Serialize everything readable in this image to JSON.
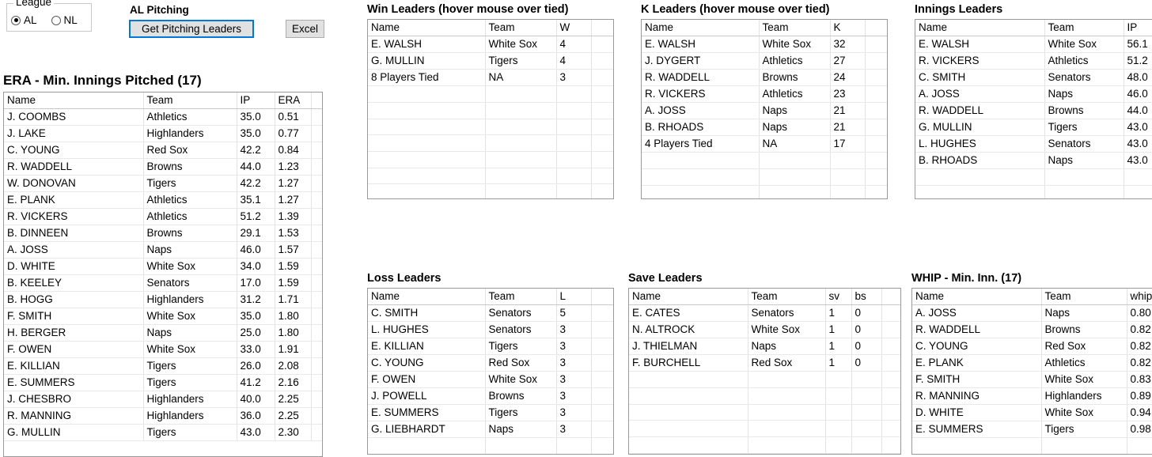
{
  "controls": {
    "league_legend": "League",
    "options": [
      {
        "label": "AL",
        "checked": true
      },
      {
        "label": "NL",
        "checked": false
      }
    ],
    "pitching_title": "AL Pitching",
    "get_leaders_label": "Get Pitching Leaders",
    "excel_label": "Excel"
  },
  "era": {
    "title": "ERA - Min. Innings Pitched (17)",
    "columns": [
      "Name",
      "Team",
      "IP",
      "ERA"
    ],
    "rows": [
      [
        "J. COOMBS",
        "Athletics",
        "35.0",
        "0.51"
      ],
      [
        "J. LAKE",
        "Highlanders",
        "35.0",
        "0.77"
      ],
      [
        "C. YOUNG",
        "Red Sox",
        "42.2",
        "0.84"
      ],
      [
        "R. WADDELL",
        "Browns",
        "44.0",
        "1.23"
      ],
      [
        "W. DONOVAN",
        "Tigers",
        "42.2",
        "1.27"
      ],
      [
        "E. PLANK",
        "Athletics",
        "35.1",
        "1.27"
      ],
      [
        "R. VICKERS",
        "Athletics",
        "51.2",
        "1.39"
      ],
      [
        "B. DINNEEN",
        "Browns",
        "29.1",
        "1.53"
      ],
      [
        "A. JOSS",
        "Naps",
        "46.0",
        "1.57"
      ],
      [
        "D. WHITE",
        "White Sox",
        "34.0",
        "1.59"
      ],
      [
        "B. KEELEY",
        "Senators",
        "17.0",
        "1.59"
      ],
      [
        "B. HOGG",
        "Highlanders",
        "31.2",
        "1.71"
      ],
      [
        "F. SMITH",
        "White Sox",
        "35.0",
        "1.80"
      ],
      [
        "H. BERGER",
        "Naps",
        "25.0",
        "1.80"
      ],
      [
        "F. OWEN",
        "White Sox",
        "33.0",
        "1.91"
      ],
      [
        "E. KILLIAN",
        "Tigers",
        "26.0",
        "2.08"
      ],
      [
        "E. SUMMERS",
        "Tigers",
        "41.2",
        "2.16"
      ],
      [
        "J. CHESBRO",
        "Highlanders",
        "40.0",
        "2.25"
      ],
      [
        "R. MANNING",
        "Highlanders",
        "36.0",
        "2.25"
      ],
      [
        "G. MULLIN",
        "Tigers",
        "43.0",
        "2.30"
      ]
    ]
  },
  "wins": {
    "title": "Win Leaders (hover mouse over tied)",
    "columns": [
      "Name",
      "Team",
      "W"
    ],
    "rows": [
      [
        "E. WALSH",
        "White Sox",
        "4"
      ],
      [
        "G. MULLIN",
        "Tigers",
        "4"
      ],
      [
        "8 Players Tied",
        "NA",
        "3"
      ]
    ],
    "blank_rows": 7
  },
  "strikeouts": {
    "title": "K Leaders (hover mouse over tied)",
    "columns": [
      "Name",
      "Team",
      "K"
    ],
    "rows": [
      [
        "E. WALSH",
        "White Sox",
        "32"
      ],
      [
        "J. DYGERT",
        "Athletics",
        "27"
      ],
      [
        "R. WADDELL",
        "Browns",
        "24"
      ],
      [
        "R. VICKERS",
        "Athletics",
        "23"
      ],
      [
        "A. JOSS",
        "Naps",
        "21"
      ],
      [
        "B. RHOADS",
        "Naps",
        "21"
      ],
      [
        "4 Players Tied",
        "NA",
        "17"
      ]
    ],
    "blank_rows": 3
  },
  "innings": {
    "title": "Innings Leaders",
    "columns": [
      "Name",
      "Team",
      "IP"
    ],
    "rows": [
      [
        "E. WALSH",
        "White Sox",
        "56.1"
      ],
      [
        "R. VICKERS",
        "Athletics",
        "51.2"
      ],
      [
        "C. SMITH",
        "Senators",
        "48.0"
      ],
      [
        "A. JOSS",
        "Naps",
        "46.0"
      ],
      [
        "R. WADDELL",
        "Browns",
        "44.0"
      ],
      [
        "G. MULLIN",
        "Tigers",
        "43.0"
      ],
      [
        "L. HUGHES",
        "Senators",
        "43.0"
      ],
      [
        "B. RHOADS",
        "Naps",
        "43.0"
      ]
    ],
    "blank_rows": 2
  },
  "losses": {
    "title": "Loss Leaders",
    "columns": [
      "Name",
      "Team",
      "L"
    ],
    "rows": [
      [
        "C. SMITH",
        "Senators",
        "5"
      ],
      [
        "L. HUGHES",
        "Senators",
        "3"
      ],
      [
        "E. KILLIAN",
        "Tigers",
        "3"
      ],
      [
        "C. YOUNG",
        "Red Sox",
        "3"
      ],
      [
        "F. OWEN",
        "White Sox",
        "3"
      ],
      [
        "J. POWELL",
        "Browns",
        "3"
      ],
      [
        "E. SUMMERS",
        "Tigers",
        "3"
      ],
      [
        "G. LIEBHARDT",
        "Naps",
        "3"
      ]
    ],
    "blank_rows": 1
  },
  "saves": {
    "title": "Save Leaders",
    "columns": [
      "Name",
      "Team",
      "sv",
      "bs"
    ],
    "rows": [
      [
        "E. CATES",
        "Senators",
        "1",
        "0"
      ],
      [
        "N. ALTROCK",
        "White Sox",
        "1",
        "0"
      ],
      [
        "J. THIELMAN",
        "Naps",
        "1",
        "0"
      ],
      [
        "F. BURCHELL",
        "Red Sox",
        "1",
        "0"
      ]
    ],
    "blank_rows": 5
  },
  "whip": {
    "title": "WHIP - Min. Inn. (17)",
    "columns": [
      "Name",
      "Team",
      "whip"
    ],
    "rows": [
      [
        "A. JOSS",
        "Naps",
        "0.80"
      ],
      [
        "R. WADDELL",
        "Browns",
        "0.82"
      ],
      [
        "C. YOUNG",
        "Red Sox",
        "0.82"
      ],
      [
        "E. PLANK",
        "Athletics",
        "0.82"
      ],
      [
        "F. SMITH",
        "White Sox",
        "0.83"
      ],
      [
        "R. MANNING",
        "Highlanders",
        "0.89"
      ],
      [
        "D. WHITE",
        "White Sox",
        "0.94"
      ],
      [
        "E. SUMMERS",
        "Tigers",
        "0.98"
      ]
    ],
    "blank_rows": 1
  }
}
